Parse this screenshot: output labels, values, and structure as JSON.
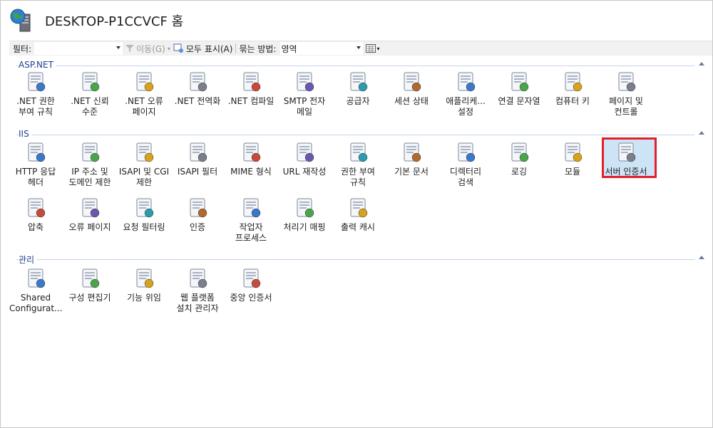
{
  "header": {
    "title": "DESKTOP-P1CCVCF 홈",
    "icon": "server-globe-icon"
  },
  "toolbar": {
    "filter_label": "필터:",
    "filter_value": "",
    "go_label": "이동(G)",
    "show_all_label": "모두 표시(A)",
    "group_by_label": "묶는 방법:",
    "group_by_value": "영역",
    "view_icon": "view-grid-icon"
  },
  "groups": [
    {
      "name": "ASP.NET"
    },
    {
      "name": "IIS"
    },
    {
      "name": "관리"
    }
  ],
  "aspnet": [
    {
      "label": ".NET 권한\n부여 규칙",
      "icon": "authorization-lock-icon"
    },
    {
      "label": ".NET 신뢰\n수준",
      "icon": "globe-check-icon"
    },
    {
      "label": ".NET 오류\n페이지",
      "icon": "error-404-icon"
    },
    {
      "label": ".NET 전역화",
      "icon": "globe-stand-icon"
    },
    {
      "label": ".NET 컴파일",
      "icon": "compile-stack-icon"
    },
    {
      "label": "SMTP 전자\n메일",
      "icon": "smtp-mail-icon"
    },
    {
      "label": "공급자",
      "icon": "providers-icon"
    },
    {
      "label": "세션 상태",
      "icon": "session-state-icon"
    },
    {
      "label": "애플리케...\n설정",
      "icon": "app-settings-icon"
    },
    {
      "label": "연결 문자열",
      "icon": "connection-string-icon"
    },
    {
      "label": "컴퓨터 키",
      "icon": "machine-key-icon"
    },
    {
      "label": "페이지 및\n컨트롤",
      "icon": "pages-controls-icon"
    }
  ],
  "iis": [
    {
      "label": "HTTP 응답\n헤더",
      "icon": "http-response-headers-icon"
    },
    {
      "label": "IP 주소 및\n도메인 제한",
      "icon": "ip-restrictions-icon"
    },
    {
      "label": "ISAPI 및 CGI\n제한",
      "icon": "isapi-cgi-icon"
    },
    {
      "label": "ISAPI 필터",
      "icon": "isapi-filter-icon"
    },
    {
      "label": "MIME 형식",
      "icon": "mime-types-icon"
    },
    {
      "label": "URL 재작성",
      "icon": "url-rewrite-icon"
    },
    {
      "label": "권한 부여\n규칙",
      "icon": "authorization-rules-icon"
    },
    {
      "label": "기본 문서",
      "icon": "default-document-icon"
    },
    {
      "label": "디렉터리\n검색",
      "icon": "directory-browsing-icon"
    },
    {
      "label": "로깅",
      "icon": "logging-icon"
    },
    {
      "label": "모듈",
      "icon": "modules-icon"
    },
    {
      "label": "서버 인증서",
      "icon": "server-certificates-icon",
      "selected": true
    },
    {
      "label": "압축",
      "icon": "compression-icon"
    },
    {
      "label": "오류 페이지",
      "icon": "error-pages-icon"
    },
    {
      "label": "요청 필터링",
      "icon": "request-filtering-icon"
    },
    {
      "label": "인증",
      "icon": "authentication-icon"
    },
    {
      "label": "작업자\n프로세스",
      "icon": "worker-processes-icon"
    },
    {
      "label": "처리기 매핑",
      "icon": "handler-mappings-icon"
    },
    {
      "label": "출력 캐시",
      "icon": "output-cache-icon"
    }
  ],
  "management": [
    {
      "label": "Shared\nConfigurat...",
      "icon": "shared-configuration-icon"
    },
    {
      "label": "구성 편집기",
      "icon": "configuration-editor-icon"
    },
    {
      "label": "기능 위임",
      "icon": "feature-delegation-icon"
    },
    {
      "label": "웹 플랫폼\n설치 관리자",
      "icon": "web-platform-installer-icon"
    },
    {
      "label": "중앙 인증서",
      "icon": "centralized-certificates-icon"
    }
  ],
  "colors": {
    "selection_border": "#e0202a",
    "group_header": "#1f3f8f",
    "selection_fill": "#cde4f7"
  }
}
